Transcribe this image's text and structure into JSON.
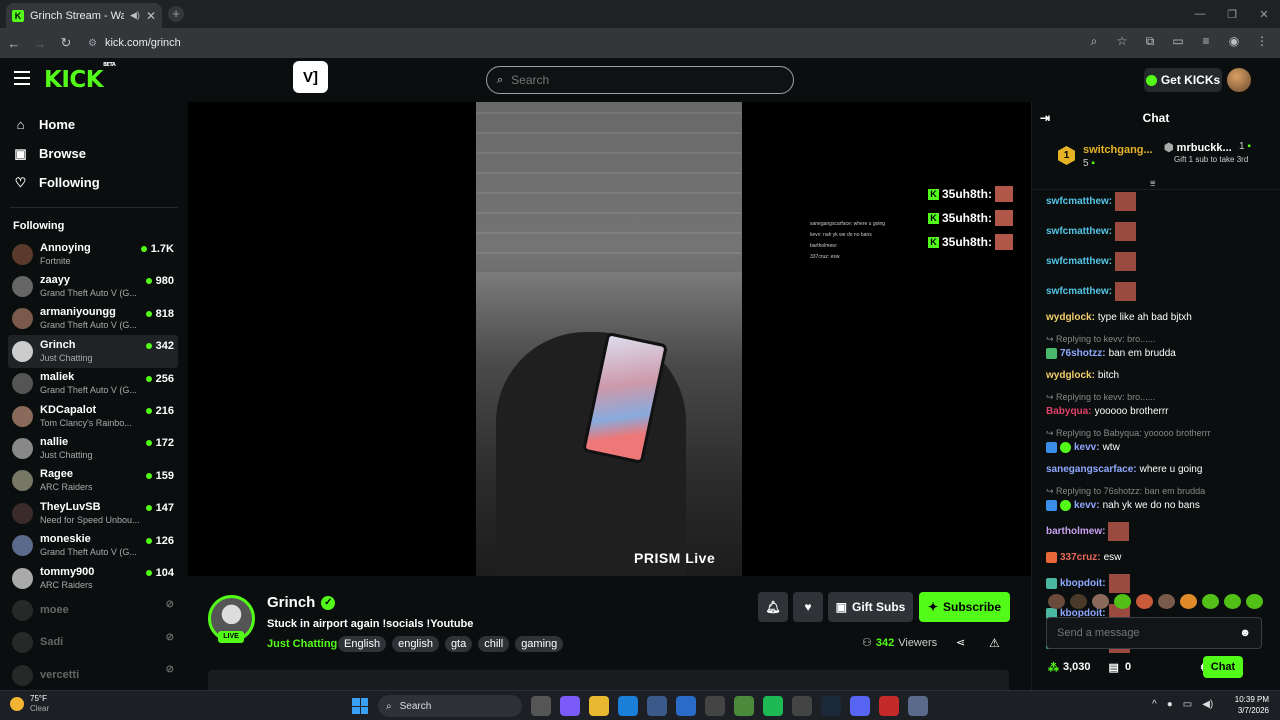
{
  "browser": {
    "tab_title": "Grinch Stream - Watch Live",
    "url": "kick.com/grinch"
  },
  "header": {
    "logo": "KICK",
    "logo_sup": "BETA",
    "search_placeholder": "Search",
    "get_kicks": "Get KICKs"
  },
  "sidebar": {
    "nav": [
      {
        "label": "Home",
        "icon": "home-icon"
      },
      {
        "label": "Browse",
        "icon": "browse-icon"
      },
      {
        "label": "Following",
        "icon": "heart-icon"
      }
    ],
    "following_heading": "Following",
    "channels": [
      {
        "name": "Annoying",
        "game": "Fortnite",
        "viewers": "1.7K",
        "color": "#5a3a2a"
      },
      {
        "name": "zaayy",
        "game": "Grand Theft Auto V (G...",
        "viewers": "980",
        "color": "#666"
      },
      {
        "name": "armaniyoungg",
        "game": "Grand Theft Auto V (G...",
        "viewers": "818",
        "color": "#7a5a4a"
      },
      {
        "name": "Grinch",
        "game": "Just Chatting",
        "viewers": "342",
        "color": "#ccc"
      },
      {
        "name": "maliek",
        "game": "Grand Theft Auto V (G...",
        "viewers": "256",
        "color": "#555"
      },
      {
        "name": "KDCapalot",
        "game": "Tom Clancy's Rainbo...",
        "viewers": "216",
        "color": "#8a6a5a"
      },
      {
        "name": "nallie",
        "game": "Just Chatting",
        "viewers": "172",
        "color": "#888"
      },
      {
        "name": "Ragee",
        "game": "ARC Raiders",
        "viewers": "159",
        "color": "#776"
      },
      {
        "name": "TheyLuvSB",
        "game": "Need for Speed Unbou...",
        "viewers": "147",
        "color": "#3a2a2a"
      },
      {
        "name": "moneskie",
        "game": "Grand Theft Auto V (G...",
        "viewers": "126",
        "color": "#5a6a8a"
      },
      {
        "name": "tommy900",
        "game": "ARC Raiders",
        "viewers": "104",
        "color": "#aaa"
      }
    ],
    "offline": [
      "moee",
      "Sadi",
      "vercetti"
    ]
  },
  "video": {
    "watermark": "PRISM Live",
    "donations": [
      "35uh8th:",
      "35uh8th:",
      "35uh8th:"
    ],
    "overlay_chat": [
      "sanegangscarface: where u going",
      "kevv: nah yk we do no bans",
      "bartholmew:",
      "337cruz: esw"
    ]
  },
  "stream": {
    "streamer": "Grinch",
    "live_label": "LIVE",
    "title": "Stuck in airport again   !socials !Youtube",
    "category": "Just Chatting",
    "tags": [
      "English",
      "english",
      "gta",
      "chill",
      "gaming"
    ],
    "gift_subs": "Gift Subs",
    "subscribe": "Subscribe",
    "viewers_count": "342",
    "viewers_label": "Viewers"
  },
  "chat": {
    "title": "Chat",
    "pinned": {
      "rank1_name": "switchgang...",
      "rank1_count": "5",
      "rank1_num": "1",
      "rank2_name": "mrbuckk...",
      "rank2_count": "1",
      "rank2_sub": "Gift 1 sub to take 3rd"
    },
    "messages": [
      {
        "type": "msg",
        "user": "swfcmatthew:",
        "color": "#53c6e8",
        "text": "",
        "emote": true
      },
      {
        "type": "msg",
        "user": "swfcmatthew:",
        "color": "#53c6e8",
        "text": "",
        "emote": true
      },
      {
        "type": "msg",
        "user": "swfcmatthew:",
        "color": "#53c6e8",
        "text": "",
        "emote": true
      },
      {
        "type": "msg",
        "user": "swfcmatthew:",
        "color": "#53c6e8",
        "text": "",
        "emote": true
      },
      {
        "type": "msg",
        "user": "wydglock:",
        "color": "#f2cf6b",
        "text": "type like ah bad bjtxh"
      },
      {
        "type": "reply",
        "text": "Replying to kevv: bro......"
      },
      {
        "type": "msg",
        "user": "76shotzz:",
        "color": "#8fa8ff",
        "text": "ban em brudda",
        "badge": "#4ab86a"
      },
      {
        "type": "msg",
        "user": "wydglock:",
        "color": "#f2cf6b",
        "text": "bitch"
      },
      {
        "type": "reply",
        "text": "Replying to kevv: bro......"
      },
      {
        "type": "msg",
        "user": "Babyqua:",
        "color": "#e0406a",
        "text": "yooooo brotherrr"
      },
      {
        "type": "reply",
        "text": "Replying to Babyqua: yooooo brotherrr"
      },
      {
        "type": "msg",
        "user": "kevv:",
        "color": "#8fa8ff",
        "text": "wtw",
        "badge": "#3a8ee8",
        "badge2": "#53fc18"
      },
      {
        "type": "msg",
        "user": "sanegangscarface:",
        "color": "#8fa8ff",
        "text": "where u going"
      },
      {
        "type": "reply",
        "text": "Replying to 76shotzz: ban em brudda"
      },
      {
        "type": "msg",
        "user": "kevv:",
        "color": "#8fa8ff",
        "text": "nah yk we do no bans",
        "badge": "#3a8ee8",
        "badge2": "#53fc18"
      },
      {
        "type": "msg",
        "user": "bartholmew:",
        "color": "#c9a0f0",
        "text": "",
        "emote": true
      },
      {
        "type": "msg",
        "user": "337cruz:",
        "color": "#e86a5a",
        "text": "esw",
        "badge": "#e8683a"
      },
      {
        "type": "msg",
        "user": "kbopdoit:",
        "color": "#8fa8ff",
        "text": "",
        "emote": true,
        "badge": "#4ab8a0"
      },
      {
        "type": "msg",
        "user": "kbopdoit:",
        "color": "#8fa8ff",
        "text": "",
        "emote": true,
        "badge": "#4ab8a0"
      },
      {
        "type": "msg",
        "user": "kbopdoit:",
        "color": "#8fa8ff",
        "text": "",
        "emote": true,
        "badge": "#4ab8a0"
      }
    ],
    "send_placeholder": "Send a message",
    "points": "3,030",
    "gifts": "0",
    "chat_button": "Chat"
  },
  "taskbar": {
    "temp": "75°F",
    "weather": "Clear",
    "search": "Search",
    "time": "10:39 PM",
    "date": "3/7/2026"
  },
  "colors": {
    "accent": "#53fc18",
    "background": "#0b0e0f"
  }
}
